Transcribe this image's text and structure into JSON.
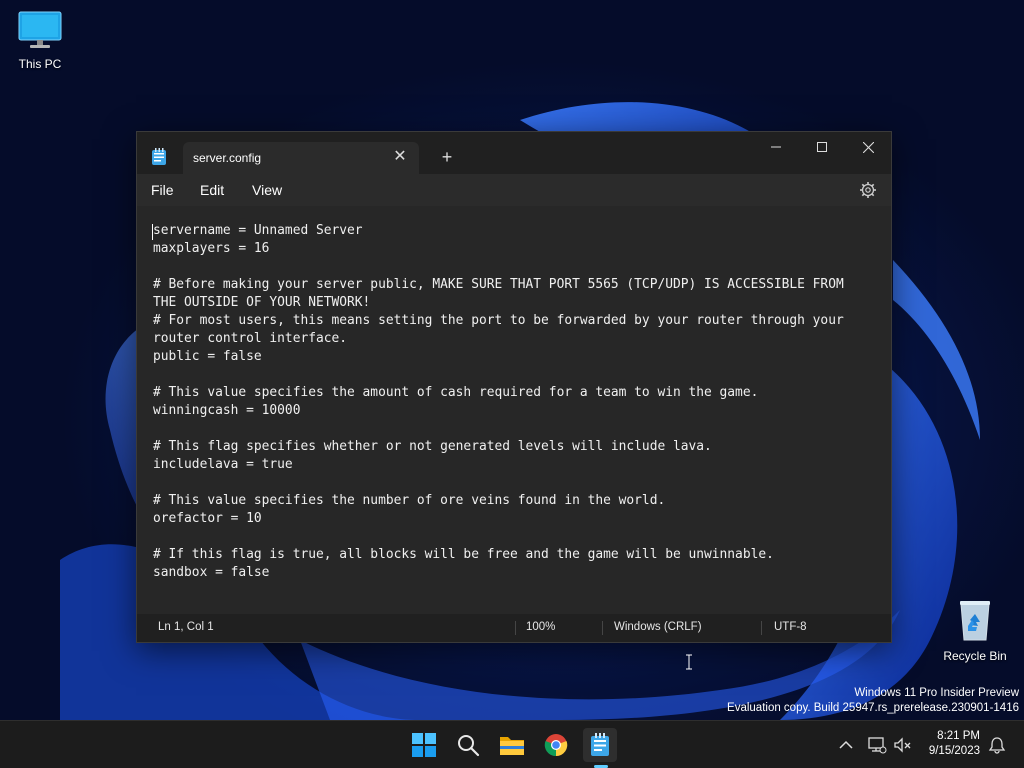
{
  "desktop": {
    "icons": [
      {
        "label": "This PC"
      },
      {
        "label": "Recycle Bin"
      }
    ]
  },
  "notepad": {
    "tab_title": "server.config",
    "new_tab_symbol": "+",
    "tab_close_symbol": "✕",
    "menu": {
      "file": "File",
      "edit": "Edit",
      "view": "View"
    },
    "content": "servername = Unnamed Server\nmaxplayers = 16\n\n# Before making your server public, MAKE SURE THAT PORT 5565 (TCP/UDP) IS ACCESSIBLE FROM THE OUTSIDE OF YOUR NETWORK!\n# For most users, this means setting the port to be forwarded by your router through your router control interface.\npublic = false\n\n# This value specifies the amount of cash required for a team to win the game.\nwinningcash = 10000\n\n# This flag specifies whether or not generated levels will include lava.\nincludelava = true\n\n# This value specifies the number of ore veins found in the world.\norefactor = 10\n\n# If this flag is true, all blocks will be free and the game will be unwinnable.\nsandbox = false",
    "status": {
      "position": "Ln 1, Col 1",
      "zoom": "100%",
      "line_ending": "Windows (CRLF)",
      "encoding": "UTF-8"
    }
  },
  "watermark": {
    "line1": "Windows 11 Pro Insider Preview",
    "line2": "Evaluation copy. Build 25947.rs_prerelease.230901-1416"
  },
  "taskbar": {
    "time": "8:21 PM",
    "date": "9/15/2023"
  },
  "colors": {
    "accent": "#60cdff",
    "editor_bg": "#272727",
    "titlebar_bg": "#202020"
  }
}
